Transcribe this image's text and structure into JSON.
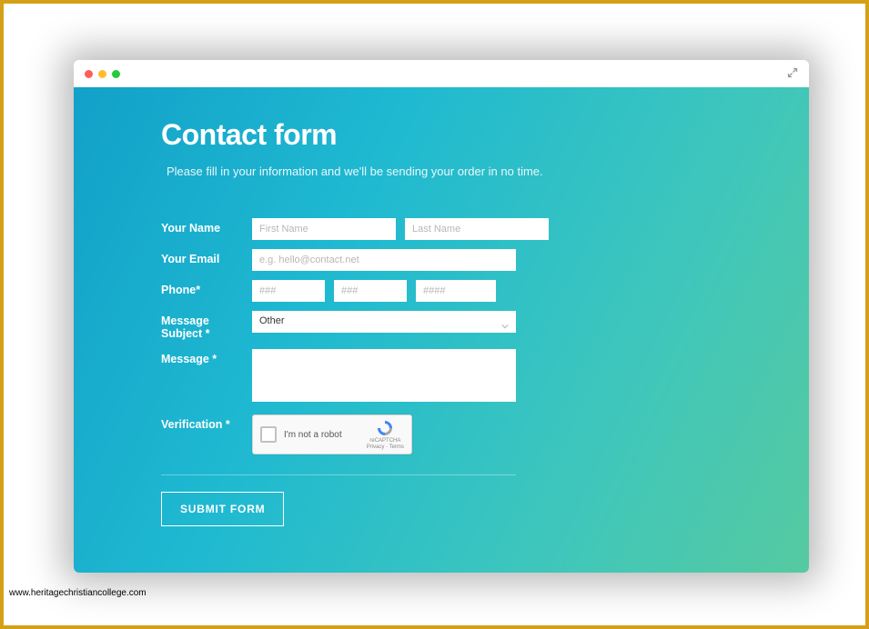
{
  "page": {
    "title": "Contact form",
    "subtitle": "Please fill in your information and we'll be sending your order in no time."
  },
  "form": {
    "name": {
      "label": "Your Name",
      "first_placeholder": "First Name",
      "last_placeholder": "Last Name"
    },
    "email": {
      "label": "Your Email",
      "placeholder": "e.g. hello@contact.net"
    },
    "phone": {
      "label": "Phone*",
      "p1_placeholder": "###",
      "p2_placeholder": "###",
      "p3_placeholder": "####"
    },
    "subject": {
      "label": "Message Subject *",
      "value": "Other"
    },
    "message": {
      "label": "Message *",
      "value": ""
    },
    "verification": {
      "label": "Verification *",
      "captcha_label": "I'm not a robot",
      "captcha_brand": "reCAPTCHA",
      "captcha_links": "Privacy · Terms"
    },
    "submit_label": "SUBMIT FORM"
  },
  "watermark": "www.heritagechristiancollege.com"
}
